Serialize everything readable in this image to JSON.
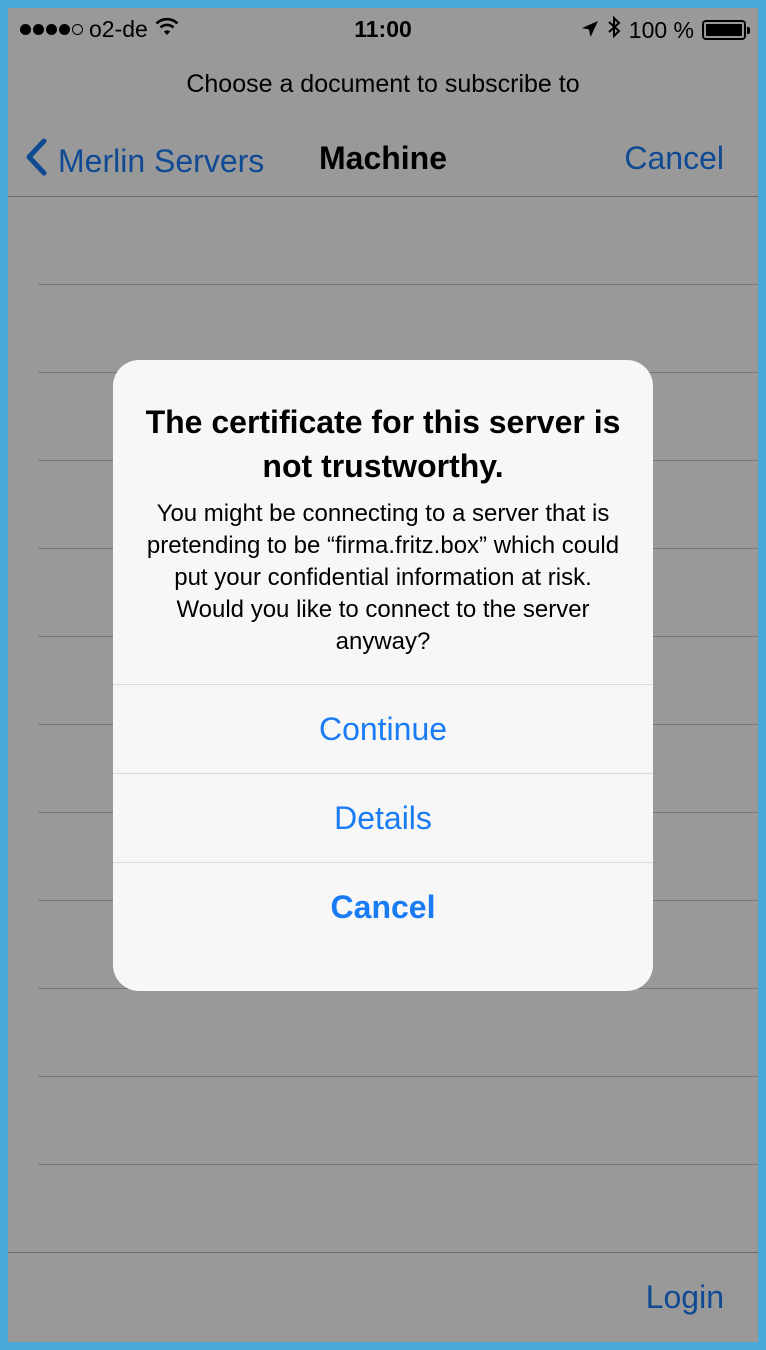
{
  "status_bar": {
    "carrier": "o2-de",
    "time": "11:00",
    "battery": "100 %",
    "battery_level": 1.0
  },
  "prompt": "Choose a document to subscribe to",
  "nav": {
    "back_label": "Merlin Servers",
    "title": "Machine",
    "cancel_label": "Cancel"
  },
  "toolbar": {
    "login_label": "Login"
  },
  "alert": {
    "title": "The certificate for this server is not trustworthy.",
    "message": "You might be connecting to a server that is pretending to be “firma.fritz.box” which could put your confidential information at risk. Would you like to connect to the server anyway?",
    "buttons": {
      "continue": "Continue",
      "details": "Details",
      "cancel": "Cancel"
    }
  },
  "icons": {
    "signal": "signal-dots-icon",
    "wifi": "wifi-icon",
    "location": "location-arrow-icon",
    "bluetooth": "bluetooth-icon",
    "battery": "battery-icon",
    "back": "chevron-left-icon"
  },
  "colors": {
    "accent": "#1a7cf5",
    "frame": "#4aa8d8"
  }
}
